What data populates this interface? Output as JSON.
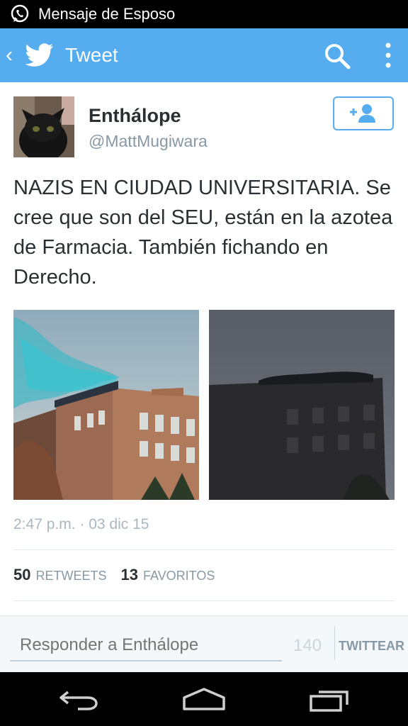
{
  "status_bar": {
    "notification_text": "Mensaje de Esposo",
    "notification_icon": "whatsapp-icon"
  },
  "app_bar": {
    "title": "Tweet",
    "icons": [
      "back-icon",
      "twitter-bird-icon",
      "search-icon",
      "overflow-menu-icon"
    ],
    "color": "#55acee"
  },
  "tweet": {
    "author_name": "Enthálope",
    "author_handle": "@MattMugiwara",
    "text": "NAZIS EN CIUDAD UNIVERSITARIA. Se cree que son del SEU, están en la azotea de Farmacia. También fichando en Derecho.",
    "timestamp": "2:47 p.m. · 03 dic 15",
    "stats": {
      "retweets_count": "50",
      "retweets_label": "RETWEETS",
      "favorites_count": "13",
      "favorites_label": "FAVORITOS"
    }
  },
  "reply": {
    "placeholder": "Responder a Enthálope",
    "char_count": "140",
    "submit_label": "TWITTEAR"
  },
  "nav_bar": {
    "icons": [
      "back-nav-icon",
      "home-nav-icon",
      "recents-nav-icon"
    ]
  }
}
